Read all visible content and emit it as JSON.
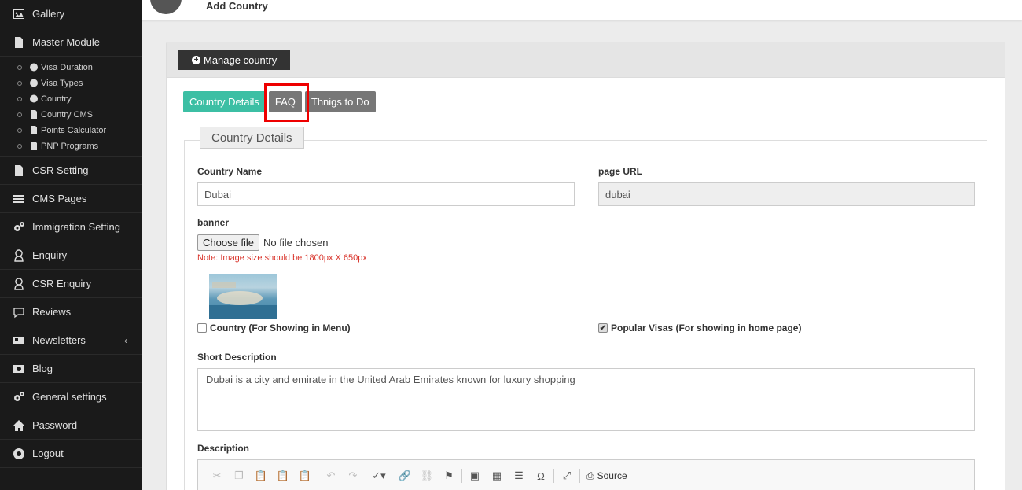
{
  "sidebar": {
    "items_top": [
      {
        "label": "Gallery",
        "icon": "image-icon"
      },
      {
        "label": "Master Module",
        "icon": "file-icon"
      }
    ],
    "submenu": [
      {
        "label": "Visa Duration",
        "icon": "globe-icon"
      },
      {
        "label": "Visa Types",
        "icon": "globe-icon"
      },
      {
        "label": "Country",
        "icon": "globe-icon"
      },
      {
        "label": "Country CMS",
        "icon": "file-icon"
      },
      {
        "label": "Points Calculator",
        "icon": "file-icon"
      },
      {
        "label": "PNP Programs",
        "icon": "file-icon"
      }
    ],
    "items_bottom": [
      {
        "label": "CSR Setting",
        "icon": "file-icon"
      },
      {
        "label": "CMS Pages",
        "icon": "layers-icon"
      },
      {
        "label": "Immigration Setting",
        "icon": "gears-icon"
      },
      {
        "label": "Enquiry",
        "icon": "user-icon"
      },
      {
        "label": "CSR Enquiry",
        "icon": "user-icon"
      },
      {
        "label": "Reviews",
        "icon": "comment-icon"
      },
      {
        "label": "Newsletters",
        "icon": "newspaper-icon",
        "chevron": "‹"
      },
      {
        "label": "Blog",
        "icon": "money-icon"
      },
      {
        "label": "General settings",
        "icon": "gears-icon"
      },
      {
        "label": "Password",
        "icon": "home-icon"
      },
      {
        "label": "Logout",
        "icon": "power-icon"
      }
    ]
  },
  "header": {
    "title": "Add Country"
  },
  "panel": {
    "manage_button": "Manage country",
    "tabs": [
      "Country Details",
      "FAQ",
      "Thnigs to Do"
    ],
    "legend": "Country Details"
  },
  "form": {
    "country_name_label": "Country Name",
    "country_name_value": "Dubai",
    "page_url_label": "page URL",
    "page_url_value": "dubai",
    "banner_label": "banner",
    "choose_file": "Choose file",
    "no_file": "No file chosen",
    "note": "Note: Image size should be 1800px X 650px",
    "country_checkbox": "Country (For Showing in Menu)",
    "popular_checkbox": "Popular Visas (For showing in home page)",
    "short_desc_label": "Short Description",
    "short_desc_value": "Dubai is a city and emirate in the United Arab Emirates known for luxury shopping",
    "description_label": "Description",
    "source_label": "Source"
  },
  "colors": {
    "accent": "#3cbfa4",
    "highlight": "#e00000",
    "sidebar": "#1a1a1a"
  }
}
